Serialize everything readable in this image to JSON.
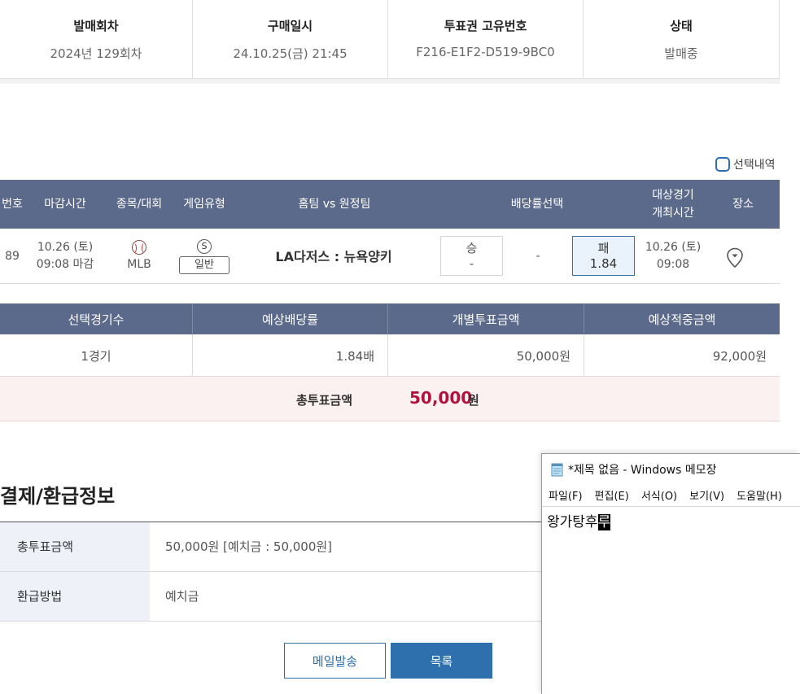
{
  "info": {
    "columns": [
      {
        "label": "발매회차",
        "value": "2024년 129회차"
      },
      {
        "label": "구매일시",
        "value": "24.10.25(금) 21:45"
      },
      {
        "label": "투표권 고유번호",
        "value": "F216-E1F2-D519-9BC0"
      },
      {
        "label": "상태",
        "value": "발매중"
      }
    ]
  },
  "selection_toggle": {
    "label": "선택내역"
  },
  "game_table": {
    "headers": {
      "no": "번호",
      "deadline": "마감시간",
      "sport": "종목/대회",
      "game_type": "게임유형",
      "teams": "홈팀 vs 원정팀",
      "odds": "배당률선택",
      "match_time_1": "대상경기",
      "match_time_2": "개최시간",
      "venue": "장소"
    },
    "row": {
      "no": "89",
      "deadline_date": "10.26 (토)",
      "deadline_time": "09:08 마감",
      "league": "MLB",
      "type_letter": "S",
      "type_label": "일반",
      "teams": "LA다저스 : 뉴욕양키",
      "win_label": "승",
      "win_value": "-",
      "draw_value": "-",
      "lose_label": "패",
      "lose_value": "1.84",
      "match_date": "10.26 (토)",
      "match_time": "09:08"
    }
  },
  "summary": {
    "headers": [
      "선택경기수",
      "예상배당률",
      "개별투표금액",
      "예상적중금액"
    ],
    "values": [
      "1경기",
      "1.84배",
      "50,000원",
      "92,000원"
    ],
    "total_label": "총투표금액",
    "total_amount": "50,000",
    "total_unit": "원"
  },
  "payment": {
    "title": "결제/환급정보",
    "rows": [
      {
        "label": "총투표금액",
        "value": "50,000원 [예치금 : 50,000원]"
      },
      {
        "label": "환급방법",
        "value": "예치금"
      }
    ]
  },
  "buttons": {
    "mail": "메일발송",
    "list": "목록"
  },
  "notepad": {
    "title": "*제목 없음 - Windows 메모장",
    "menu": [
      "파일(F)",
      "편집(E)",
      "서식(O)",
      "보기(V)",
      "도움말(H)"
    ],
    "text": "왕가탕후",
    "composing": "루"
  },
  "colors": {
    "header_bg": "#5b6a8b",
    "accent_blue": "#2e6fad",
    "total_red": "#b0143c",
    "total_bg": "#fcf1f1"
  }
}
